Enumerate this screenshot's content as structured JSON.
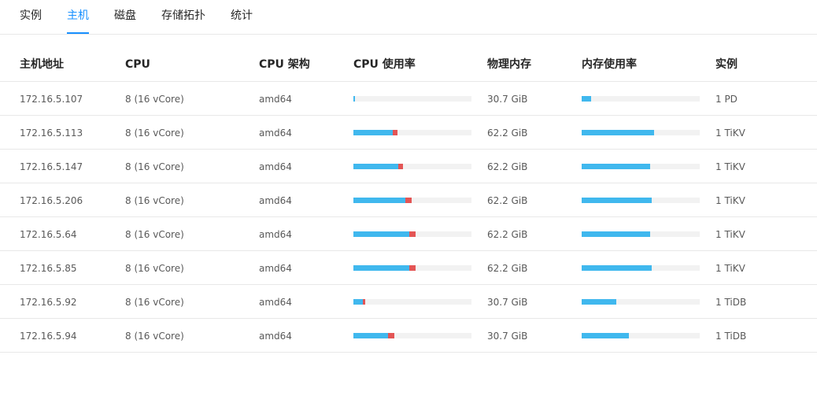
{
  "tabs": [
    {
      "label": "实例",
      "active": false
    },
    {
      "label": "主机",
      "active": true
    },
    {
      "label": "磁盘",
      "active": false
    },
    {
      "label": "存储拓扑",
      "active": false
    },
    {
      "label": "统计",
      "active": false
    }
  ],
  "columns": [
    "主机地址",
    "CPU",
    "CPU 架构",
    "CPU 使用率",
    "物理内存",
    "内存使用率",
    "实例"
  ],
  "colors": {
    "accent": "#1890ff",
    "bar_user": "#40b8ee",
    "bar_system": "#e35555",
    "bar_track": "#f2f2f2"
  },
  "rows": [
    {
      "address": "172.16.5.107",
      "cpu": "8 (16 vCore)",
      "arch": "amd64",
      "cpu_user": 0.01,
      "cpu_sys": 0.0,
      "memory": "30.7 GiB",
      "mem_usage": 0.08,
      "instances": "1 PD"
    },
    {
      "address": "172.16.5.113",
      "cpu": "8 (16 vCore)",
      "arch": "amd64",
      "cpu_user": 0.33,
      "cpu_sys": 0.04,
      "memory": "62.2 GiB",
      "mem_usage": 0.61,
      "instances": "1 TiKV"
    },
    {
      "address": "172.16.5.147",
      "cpu": "8 (16 vCore)",
      "arch": "amd64",
      "cpu_user": 0.38,
      "cpu_sys": 0.04,
      "memory": "62.2 GiB",
      "mem_usage": 0.58,
      "instances": "1 TiKV"
    },
    {
      "address": "172.16.5.206",
      "cpu": "8 (16 vCore)",
      "arch": "amd64",
      "cpu_user": 0.44,
      "cpu_sys": 0.05,
      "memory": "62.2 GiB",
      "mem_usage": 0.59,
      "instances": "1 TiKV"
    },
    {
      "address": "172.16.5.64",
      "cpu": "8 (16 vCore)",
      "arch": "amd64",
      "cpu_user": 0.47,
      "cpu_sys": 0.05,
      "memory": "62.2 GiB",
      "mem_usage": 0.58,
      "instances": "1 TiKV"
    },
    {
      "address": "172.16.5.85",
      "cpu": "8 (16 vCore)",
      "arch": "amd64",
      "cpu_user": 0.47,
      "cpu_sys": 0.05,
      "memory": "62.2 GiB",
      "mem_usage": 0.59,
      "instances": "1 TiKV"
    },
    {
      "address": "172.16.5.92",
      "cpu": "8 (16 vCore)",
      "arch": "amd64",
      "cpu_user": 0.08,
      "cpu_sys": 0.02,
      "memory": "30.7 GiB",
      "mem_usage": 0.29,
      "instances": "1 TiDB"
    },
    {
      "address": "172.16.5.94",
      "cpu": "8 (16 vCore)",
      "arch": "amd64",
      "cpu_user": 0.29,
      "cpu_sys": 0.05,
      "memory": "30.7 GiB",
      "mem_usage": 0.4,
      "instances": "1 TiDB"
    }
  ]
}
